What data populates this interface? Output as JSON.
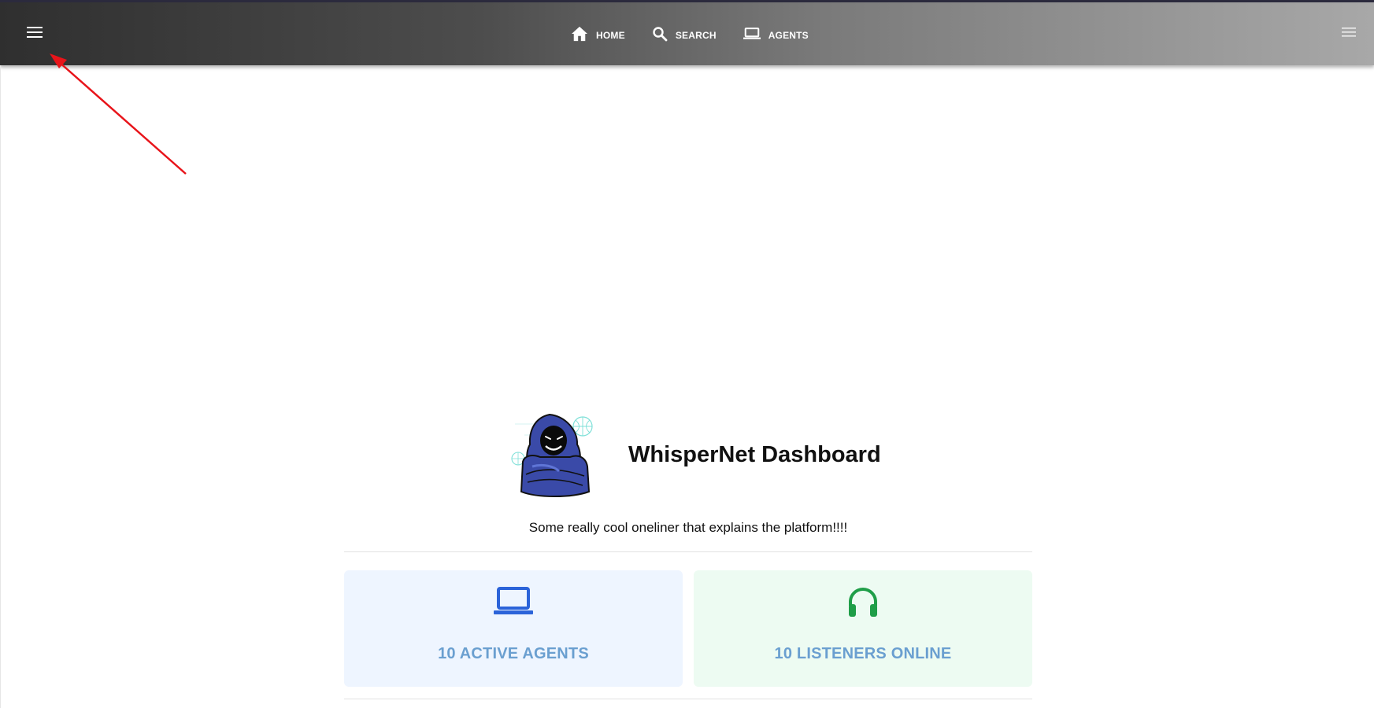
{
  "header": {
    "left_menu_icon": "menu-icon",
    "right_menu_icon": "menu-icon",
    "nav": [
      {
        "label": "HOME",
        "icon": "home-icon"
      },
      {
        "label": "SEARCH",
        "icon": "search-icon"
      },
      {
        "label": "AGENTS",
        "icon": "laptop-icon"
      }
    ]
  },
  "main": {
    "logo_icon": "hooded-hacker-logo",
    "title": "WhisperNet Dashboard",
    "tagline": "Some really cool oneliner that explains the platform!!!!"
  },
  "cards": [
    {
      "label": "10 ACTIVE AGENTS",
      "icon": "laptop-icon",
      "icon_color": "#2b63d9"
    },
    {
      "label": "10 LISTENERS ONLINE",
      "icon": "headphones-icon",
      "icon_color": "#1f9e48"
    }
  ],
  "colors": {
    "card_text": "#6a9fd0",
    "agents_card_bg": "#eef5ff",
    "listeners_card_bg": "#edfbf2",
    "annotation_arrow": "#e8141a"
  }
}
